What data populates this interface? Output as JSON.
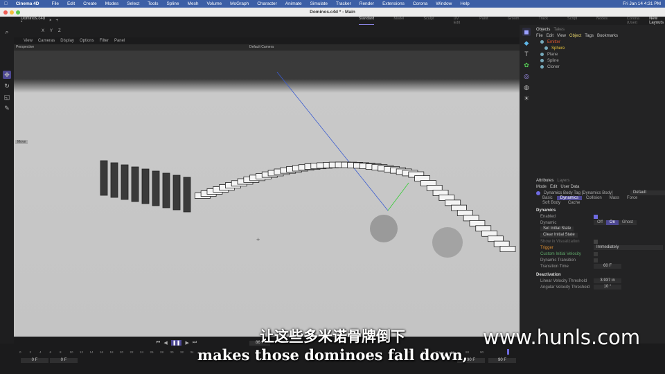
{
  "menubar": {
    "app": "Cinema 4D",
    "items": [
      "File",
      "Edit",
      "Create",
      "Modes",
      "Select",
      "Tools",
      "Spline",
      "Mesh",
      "Volume",
      "MoGraph",
      "Character",
      "Animate",
      "Simulate",
      "Tracker",
      "Render",
      "Extensions",
      "Corona",
      "Window",
      "Help"
    ],
    "clock": "Fri Jan 14  4:31 PM"
  },
  "window": {
    "title": "Dominos.c4d * - Main",
    "doc_tab": "Dominos.c4d *"
  },
  "layouts": {
    "items": [
      "Standard",
      "Model",
      "Sculpt",
      "UV Edit",
      "Paint",
      "Groom",
      "Track",
      "Script",
      "Nodes",
      "Corona (User)"
    ],
    "active": "Standard",
    "new_layouts": "New Layouts"
  },
  "coord_labels": [
    "X",
    "Y",
    "Z"
  ],
  "viewport": {
    "menu": [
      "View",
      "Cameras",
      "Display",
      "Options",
      "Filter",
      "Panel"
    ],
    "projection": "Perspective",
    "camera": "Default Camera",
    "move_label": "Move"
  },
  "objects": {
    "tabs": [
      "Objects",
      "Takes"
    ],
    "menu": [
      "File",
      "Edit",
      "View",
      "Object",
      "Tags",
      "Bookmarks"
    ],
    "items": [
      {
        "name": "Emitter",
        "color": "#d9542e"
      },
      {
        "name": "Sphere",
        "color": "#e6c23a"
      },
      {
        "name": "Plane",
        "color": "#aaaaaa"
      },
      {
        "name": "Spline",
        "color": "#aaaaaa"
      },
      {
        "name": "Cloner",
        "color": "#aaaaaa"
      }
    ]
  },
  "attributes": {
    "tabs": [
      "Attributes",
      "Layers"
    ],
    "menu": [
      "Mode",
      "Edit",
      "User Data"
    ],
    "tag_title": "Dynamics Body Tag [Dynamics Body]",
    "preset": "Default",
    "subtabs": [
      "Basic",
      "Dynamics",
      "Collision",
      "Mass",
      "Force",
      "Soft Body",
      "Cache"
    ],
    "active_subtab": "Dynamics",
    "section1": "Dynamics",
    "enabled": "Enabled",
    "dynamic": "Dynamic",
    "dynamic_options": [
      "Off",
      "On",
      "Ghost"
    ],
    "dynamic_value": "On",
    "set_initial": "Set Initial State",
    "clear_initial": "Clear Initial State",
    "show_vis": "Show in Visualization",
    "trigger": "Trigger",
    "trigger_value": "Immediately",
    "custom_vel": "Custom Initial Velocity",
    "dyn_transition": "Dynamic Transition",
    "transition_time": "Transition Time",
    "transition_value": "60 F",
    "section2": "Deactivation",
    "lin_thresh": "Linear Velocity Threshold",
    "lin_value": "3.937 in",
    "ang_thresh": "Angular Velocity Threshold",
    "ang_value": "10 °"
  },
  "timeline": {
    "ticks": [
      "0",
      "2",
      "4",
      "6",
      "8",
      "10",
      "12",
      "14",
      "16",
      "18",
      "20",
      "22",
      "24",
      "26",
      "28",
      "30",
      "32",
      "34",
      "80",
      "82",
      "84",
      "86",
      "88",
      "90"
    ],
    "start": "0 F",
    "start2": "0 F",
    "end": "90 F",
    "end2": "90 F",
    "current": "86 F",
    "progress": 0.95
  },
  "subtitles": {
    "cn": "让这些多米诺骨牌倒下",
    "en": "makes those dominoes fall down,"
  },
  "watermark": "www.hunls.com"
}
